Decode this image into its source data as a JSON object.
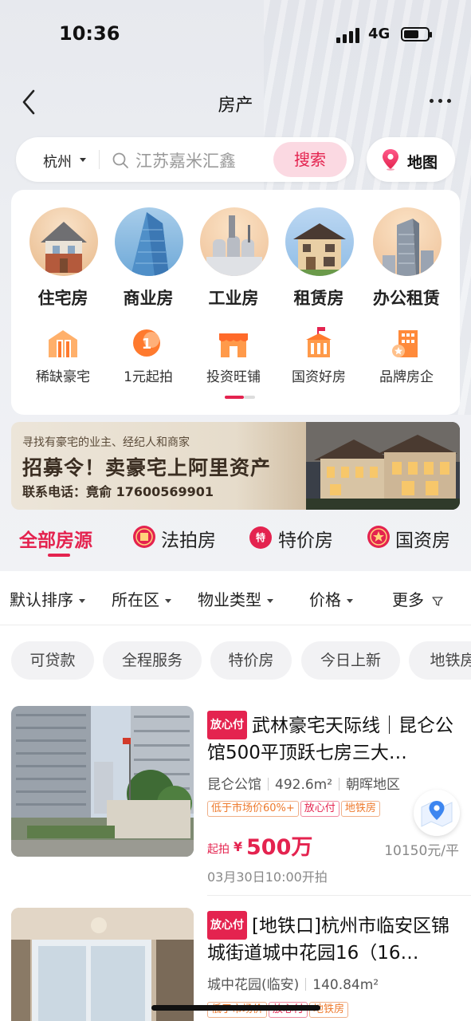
{
  "status": {
    "time": "10:36",
    "network": "4G"
  },
  "nav": {
    "title": "房产"
  },
  "search": {
    "city": "杭州",
    "placeholder": "江苏嘉米汇鑫",
    "button": "搜索",
    "map_label": "地图"
  },
  "categories_main": [
    {
      "label": "住宅房",
      "icon": "house-icon"
    },
    {
      "label": "商业房",
      "icon": "skyscraper-icon"
    },
    {
      "label": "工业房",
      "icon": "factory-icon"
    },
    {
      "label": "租赁房",
      "icon": "villa-icon"
    },
    {
      "label": "办公租赁",
      "icon": "office-tower-icon"
    }
  ],
  "categories_sub": [
    {
      "label": "稀缺豪宅",
      "icon": "mansion-icon"
    },
    {
      "label": "1元起拍",
      "icon": "one-yuan-coin-icon"
    },
    {
      "label": "投资旺铺",
      "icon": "shop-icon"
    },
    {
      "label": "国资好房",
      "icon": "state-building-icon"
    },
    {
      "label": "品牌房企",
      "icon": "brand-building-icon"
    }
  ],
  "banner": {
    "subtitle": "寻找有豪宅的业主、经纪人和商家",
    "title": "招募令！卖豪宅上阿里资产",
    "contact": "联系电话：竟俞 17600569901"
  },
  "tabs": [
    {
      "label": "全部房源",
      "active": true
    },
    {
      "label": "法拍房",
      "icon": "court-auction-icon"
    },
    {
      "label": "特价房",
      "icon": "special-price-icon",
      "badge": "特"
    },
    {
      "label": "国资房",
      "icon": "state-owned-icon"
    }
  ],
  "filters": [
    {
      "label": "默认排序"
    },
    {
      "label": "所在区"
    },
    {
      "label": "物业类型"
    },
    {
      "label": "价格"
    },
    {
      "label": "更多"
    }
  ],
  "chips": [
    "可贷款",
    "全程服务",
    "特价房",
    "今日上新",
    "地铁房"
  ],
  "listings": [
    {
      "tag": "放心付",
      "title": "武林豪宅天际线｜昆仑公馆500平顶跃七房三大…",
      "community": "昆仑公馆",
      "area": "492.6m²",
      "district": "朝晖地区",
      "badges": [
        "低于市场价60%+",
        "放心付",
        "地铁房"
      ],
      "price_prefix": "起拍",
      "price_currency": "¥",
      "price": "500万",
      "unit_price": "10150元/平",
      "auction_time": "03月30日10:00开拍"
    },
    {
      "tag": "放心付",
      "title": "[地铁口]杭州市临安区锦城街道城中花园16（16…",
      "community": "城中花园(临安)",
      "area": "140.84m²",
      "badges": [
        "低于市场价",
        "放心付",
        "地铁房"
      ]
    }
  ],
  "colors": {
    "accent": "#e4234f",
    "badge_orange": "#ee7a2d"
  }
}
